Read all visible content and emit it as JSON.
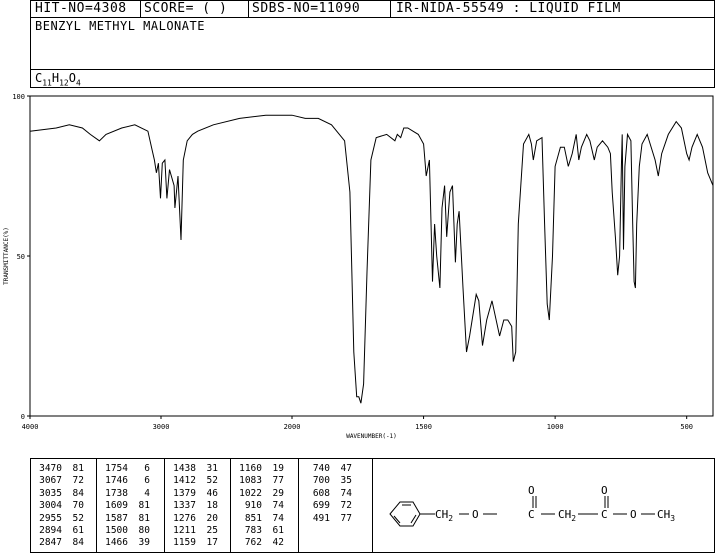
{
  "header": {
    "hit_no": "HIT-NO=4308",
    "score": "SCORE=  (   )",
    "sdbs_no": "SDBS-NO=11090",
    "ir_nida": "IR-NIDA-55549 : LIQUID FILM"
  },
  "compound": {
    "name": "BENZYL METHYL MALONATE",
    "formula_c": "C",
    "formula_c_sub": "11",
    "formula_h": "H",
    "formula_h_sub": "12",
    "formula_o": "O",
    "formula_o_sub": "4"
  },
  "chart_data": {
    "type": "line",
    "xlabel": "WAVENUMBER(-1)",
    "ylabel": "TRANSMITTANCE(%)",
    "xlim": [
      4000,
      400
    ],
    "ylim": [
      0,
      100
    ],
    "x_ticks": [
      "4000",
      "3000",
      "2000",
      "1500",
      "1000",
      "500"
    ],
    "y_ticks": [
      "100",
      "50",
      "0"
    ],
    "series": [
      {
        "points": [
          [
            4000,
            89
          ],
          [
            3800,
            90
          ],
          [
            3700,
            91
          ],
          [
            3600,
            90
          ],
          [
            3540,
            88
          ],
          [
            3470,
            86
          ],
          [
            3420,
            88
          ],
          [
            3300,
            90
          ],
          [
            3200,
            91
          ],
          [
            3100,
            89
          ],
          [
            3067,
            83
          ],
          [
            3050,
            80
          ],
          [
            3035,
            76
          ],
          [
            3020,
            79
          ],
          [
            3004,
            68
          ],
          [
            2990,
            79
          ],
          [
            2970,
            80
          ],
          [
            2955,
            68
          ],
          [
            2935,
            77
          ],
          [
            2900,
            72
          ],
          [
            2894,
            65
          ],
          [
            2870,
            75
          ],
          [
            2847,
            55
          ],
          [
            2830,
            80
          ],
          [
            2800,
            86
          ],
          [
            2760,
            88
          ],
          [
            2720,
            89
          ],
          [
            2600,
            91
          ],
          [
            2400,
            93
          ],
          [
            2200,
            94
          ],
          [
            2000,
            94
          ],
          [
            1950,
            93
          ],
          [
            1900,
            93
          ],
          [
            1850,
            91
          ],
          [
            1800,
            86
          ],
          [
            1780,
            70
          ],
          [
            1765,
            20
          ],
          [
            1754,
            6
          ],
          [
            1746,
            6
          ],
          [
            1738,
            4
          ],
          [
            1728,
            10
          ],
          [
            1715,
            45
          ],
          [
            1700,
            80
          ],
          [
            1680,
            87
          ],
          [
            1640,
            88
          ],
          [
            1609,
            86
          ],
          [
            1600,
            88
          ],
          [
            1587,
            87
          ],
          [
            1575,
            90
          ],
          [
            1560,
            90
          ],
          [
            1540,
            89
          ],
          [
            1520,
            88
          ],
          [
            1500,
            85
          ],
          [
            1490,
            75
          ],
          [
            1478,
            80
          ],
          [
            1466,
            42
          ],
          [
            1458,
            60
          ],
          [
            1450,
            50
          ],
          [
            1438,
            40
          ],
          [
            1430,
            65
          ],
          [
            1420,
            72
          ],
          [
            1412,
            56
          ],
          [
            1400,
            70
          ],
          [
            1390,
            72
          ],
          [
            1379,
            48
          ],
          [
            1372,
            60
          ],
          [
            1365,
            64
          ],
          [
            1350,
            40
          ],
          [
            1337,
            20
          ],
          [
            1325,
            25
          ],
          [
            1300,
            38
          ],
          [
            1290,
            36
          ],
          [
            1276,
            22
          ],
          [
            1260,
            30
          ],
          [
            1240,
            36
          ],
          [
            1211,
            25
          ],
          [
            1195,
            30
          ],
          [
            1180,
            30
          ],
          [
            1165,
            28
          ],
          [
            1159,
            17
          ],
          [
            1150,
            20
          ],
          [
            1140,
            60
          ],
          [
            1120,
            85
          ],
          [
            1100,
            88
          ],
          [
            1090,
            85
          ],
          [
            1083,
            80
          ],
          [
            1070,
            86
          ],
          [
            1050,
            87
          ],
          [
            1040,
            60
          ],
          [
            1030,
            35
          ],
          [
            1022,
            30
          ],
          [
            1010,
            50
          ],
          [
            1000,
            78
          ],
          [
            980,
            84
          ],
          [
            965,
            84
          ],
          [
            950,
            78
          ],
          [
            935,
            82
          ],
          [
            920,
            88
          ],
          [
            910,
            80
          ],
          [
            900,
            84
          ],
          [
            880,
            88
          ],
          [
            868,
            86
          ],
          [
            851,
            80
          ],
          [
            840,
            84
          ],
          [
            820,
            86
          ],
          [
            800,
            84
          ],
          [
            790,
            82
          ],
          [
            783,
            70
          ],
          [
            770,
            55
          ],
          [
            762,
            44
          ],
          [
            755,
            50
          ],
          [
            748,
            78
          ],
          [
            745,
            88
          ],
          [
            740,
            52
          ],
          [
            735,
            78
          ],
          [
            725,
            88
          ],
          [
            712,
            86
          ],
          [
            705,
            60
          ],
          [
            700,
            42
          ],
          [
            695,
            40
          ],
          [
            690,
            60
          ],
          [
            680,
            78
          ],
          [
            670,
            85
          ],
          [
            650,
            88
          ],
          [
            620,
            80
          ],
          [
            608,
            75
          ],
          [
            595,
            82
          ],
          [
            570,
            88
          ],
          [
            540,
            92
          ],
          [
            520,
            90
          ],
          [
            500,
            82
          ],
          [
            491,
            80
          ],
          [
            480,
            84
          ],
          [
            460,
            88
          ],
          [
            440,
            84
          ],
          [
            420,
            76
          ],
          [
            400,
            72
          ]
        ]
      }
    ]
  },
  "peaks": {
    "columns": [
      [
        [
          "3470",
          "81"
        ],
        [
          "3067",
          "72"
        ],
        [
          "3035",
          "84"
        ],
        [
          "3004",
          "70"
        ],
        [
          "2955",
          "52"
        ],
        [
          "2894",
          "61"
        ],
        [
          "2847",
          "84"
        ]
      ],
      [
        [
          "1754",
          "6"
        ],
        [
          "1746",
          "6"
        ],
        [
          "1738",
          "4"
        ],
        [
          "1609",
          "81"
        ],
        [
          "1587",
          "81"
        ],
        [
          "1500",
          "80"
        ],
        [
          "1466",
          "39"
        ]
      ],
      [
        [
          "1438",
          "31"
        ],
        [
          "1412",
          "52"
        ],
        [
          "1379",
          "46"
        ],
        [
          "1337",
          "18"
        ],
        [
          "1276",
          "20"
        ],
        [
          "1211",
          "25"
        ],
        [
          "1159",
          "17"
        ]
      ],
      [
        [
          "1160",
          "19"
        ],
        [
          "1083",
          "77"
        ],
        [
          "1022",
          "29"
        ],
        [
          "910",
          "74"
        ],
        [
          "851",
          "74"
        ],
        [
          "783",
          "61"
        ],
        [
          "762",
          "42"
        ]
      ],
      [
        [
          "740",
          "47"
        ],
        [
          "700",
          "35"
        ],
        [
          "608",
          "74"
        ],
        [
          "699",
          "72"
        ],
        [
          "491",
          "77"
        ]
      ]
    ]
  },
  "structure": {
    "ch2": "CH",
    "ch2_sub": "2",
    "o1": "O",
    "c1": "C",
    "o_top1": "O",
    "ch2b": "CH",
    "ch2b_sub": "2",
    "c2": "C",
    "o_top2": "O",
    "o2": "O",
    "ch3": "CH",
    "ch3_sub": "3"
  }
}
